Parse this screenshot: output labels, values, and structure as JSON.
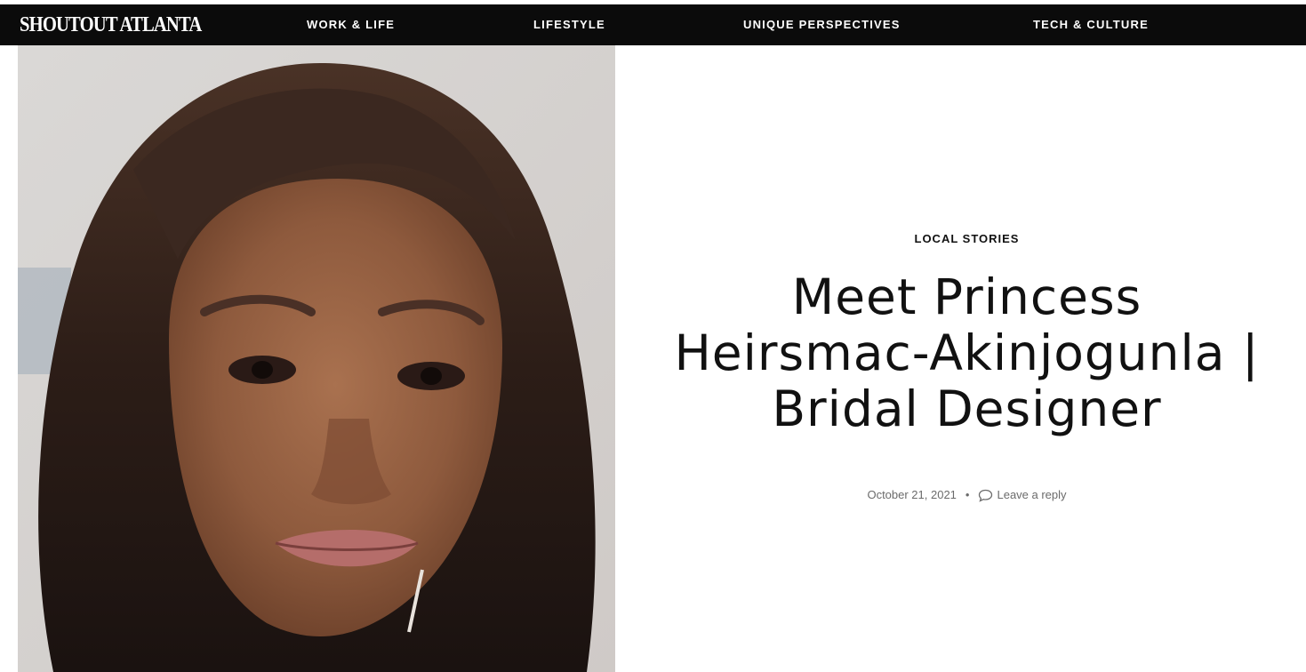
{
  "header": {
    "logo": "SHOUTOUT ATLANTA",
    "nav": [
      "WORK & LIFE",
      "LIFESTYLE",
      "UNIQUE PERSPECTIVES",
      "TECH & CULTURE"
    ]
  },
  "article": {
    "category": "LOCAL STORIES",
    "title": "Meet Princess Heirsmac-Akinjogunla | Bridal Designer",
    "date": "October 21, 2021",
    "separator": "•",
    "comments_label": "Leave a reply"
  },
  "colors": {
    "navbar_bg": "#0b0b0b",
    "nav_text": "#ffffff",
    "meta_text": "#6b6b6b"
  },
  "icons": [
    "comment-bubble-icon"
  ]
}
